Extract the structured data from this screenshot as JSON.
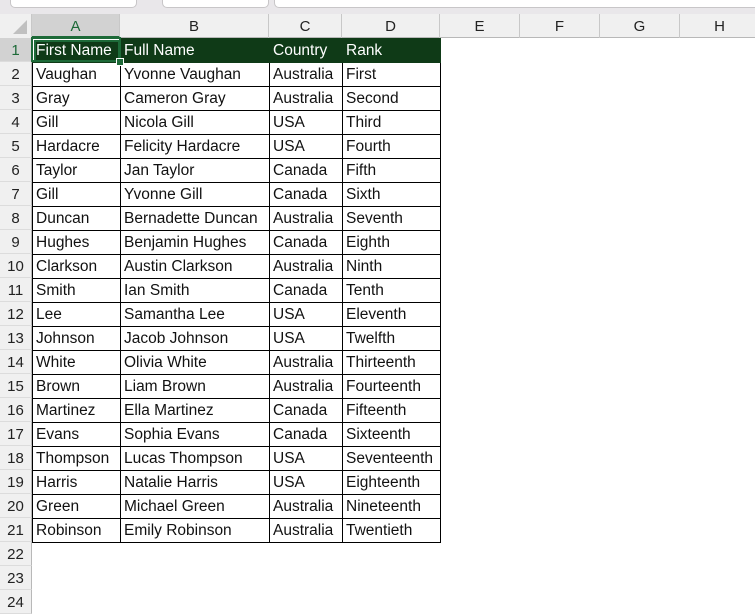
{
  "toolbar": {
    "boxes": [
      "name-box",
      "function-box",
      "formula-bar"
    ]
  },
  "sheet": {
    "selected_cell": "A1",
    "columns": [
      "A",
      "B",
      "C",
      "D",
      "E",
      "F",
      "G",
      "H"
    ],
    "row_numbers": [
      "1",
      "2",
      "3",
      "4",
      "5",
      "6",
      "7",
      "8",
      "9",
      "10",
      "11",
      "12",
      "13",
      "14",
      "15",
      "16",
      "17",
      "18",
      "19",
      "20",
      "21",
      "22",
      "23",
      "24"
    ],
    "header_fill": "#0f3a17",
    "header": [
      "First Name",
      "Full Name",
      "Country",
      "Rank"
    ],
    "rows": [
      [
        "Vaughan",
        "Yvonne Vaughan",
        "Australia",
        "First"
      ],
      [
        "Gray",
        "Cameron Gray",
        "Australia",
        "Second"
      ],
      [
        "Gill",
        "Nicola Gill",
        "USA",
        "Third"
      ],
      [
        "Hardacre",
        "Felicity Hardacre",
        "USA",
        "Fourth"
      ],
      [
        "Taylor",
        "Jan Taylor",
        "Canada",
        "Fifth"
      ],
      [
        "Gill",
        "Yvonne Gill",
        "Canada",
        "Sixth"
      ],
      [
        "Duncan",
        "Bernadette Duncan",
        "Australia",
        "Seventh"
      ],
      [
        "Hughes",
        "Benjamin Hughes",
        "Canada",
        "Eighth"
      ],
      [
        "Clarkson",
        "Austin Clarkson",
        "Australia",
        "Ninth"
      ],
      [
        "Smith",
        "Ian Smith",
        "Canada",
        "Tenth"
      ],
      [
        "Lee",
        "Samantha Lee",
        "USA",
        "Eleventh"
      ],
      [
        "Johnson",
        "Jacob Johnson",
        "USA",
        "Twelfth"
      ],
      [
        "White",
        "Olivia White",
        "Australia",
        "Thirteenth"
      ],
      [
        "Brown",
        "Liam Brown",
        "Australia",
        "Fourteenth"
      ],
      [
        "Martinez",
        "Ella Martinez",
        "Canada",
        "Fifteenth"
      ],
      [
        "Evans",
        "Sophia Evans",
        "Canada",
        "Sixteenth"
      ],
      [
        "Thompson",
        "Lucas Thompson",
        "USA",
        "Seventeenth"
      ],
      [
        "Harris",
        "Natalie Harris",
        "USA",
        "Eighteenth"
      ],
      [
        "Green",
        "Michael Green",
        "Australia",
        "Nineteenth"
      ],
      [
        "Robinson",
        "Emily Robinson",
        "Australia",
        "Twentieth"
      ]
    ]
  }
}
